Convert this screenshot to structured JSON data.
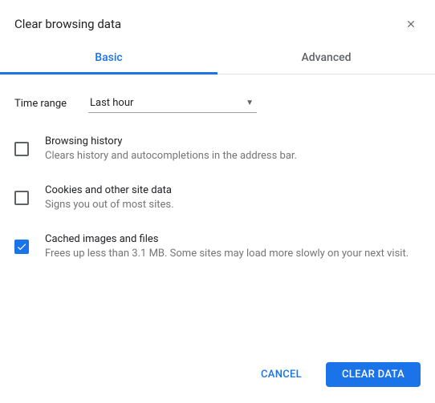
{
  "dialog": {
    "title": "Clear browsing data"
  },
  "tabs": {
    "basic": "Basic",
    "advanced": "Advanced"
  },
  "timeRange": {
    "label": "Time range",
    "value": "Last hour"
  },
  "options": [
    {
      "checked": false,
      "title": "Browsing history",
      "desc": "Clears history and autocompletions in the address bar."
    },
    {
      "checked": false,
      "title": "Cookies and other site data",
      "desc": "Signs you out of most sites."
    },
    {
      "checked": true,
      "title": "Cached images and files",
      "desc": "Frees up less than 3.1 MB. Some sites may load more slowly on your next visit."
    }
  ],
  "footer": {
    "cancel": "CANCEL",
    "confirm": "CLEAR DATA"
  }
}
